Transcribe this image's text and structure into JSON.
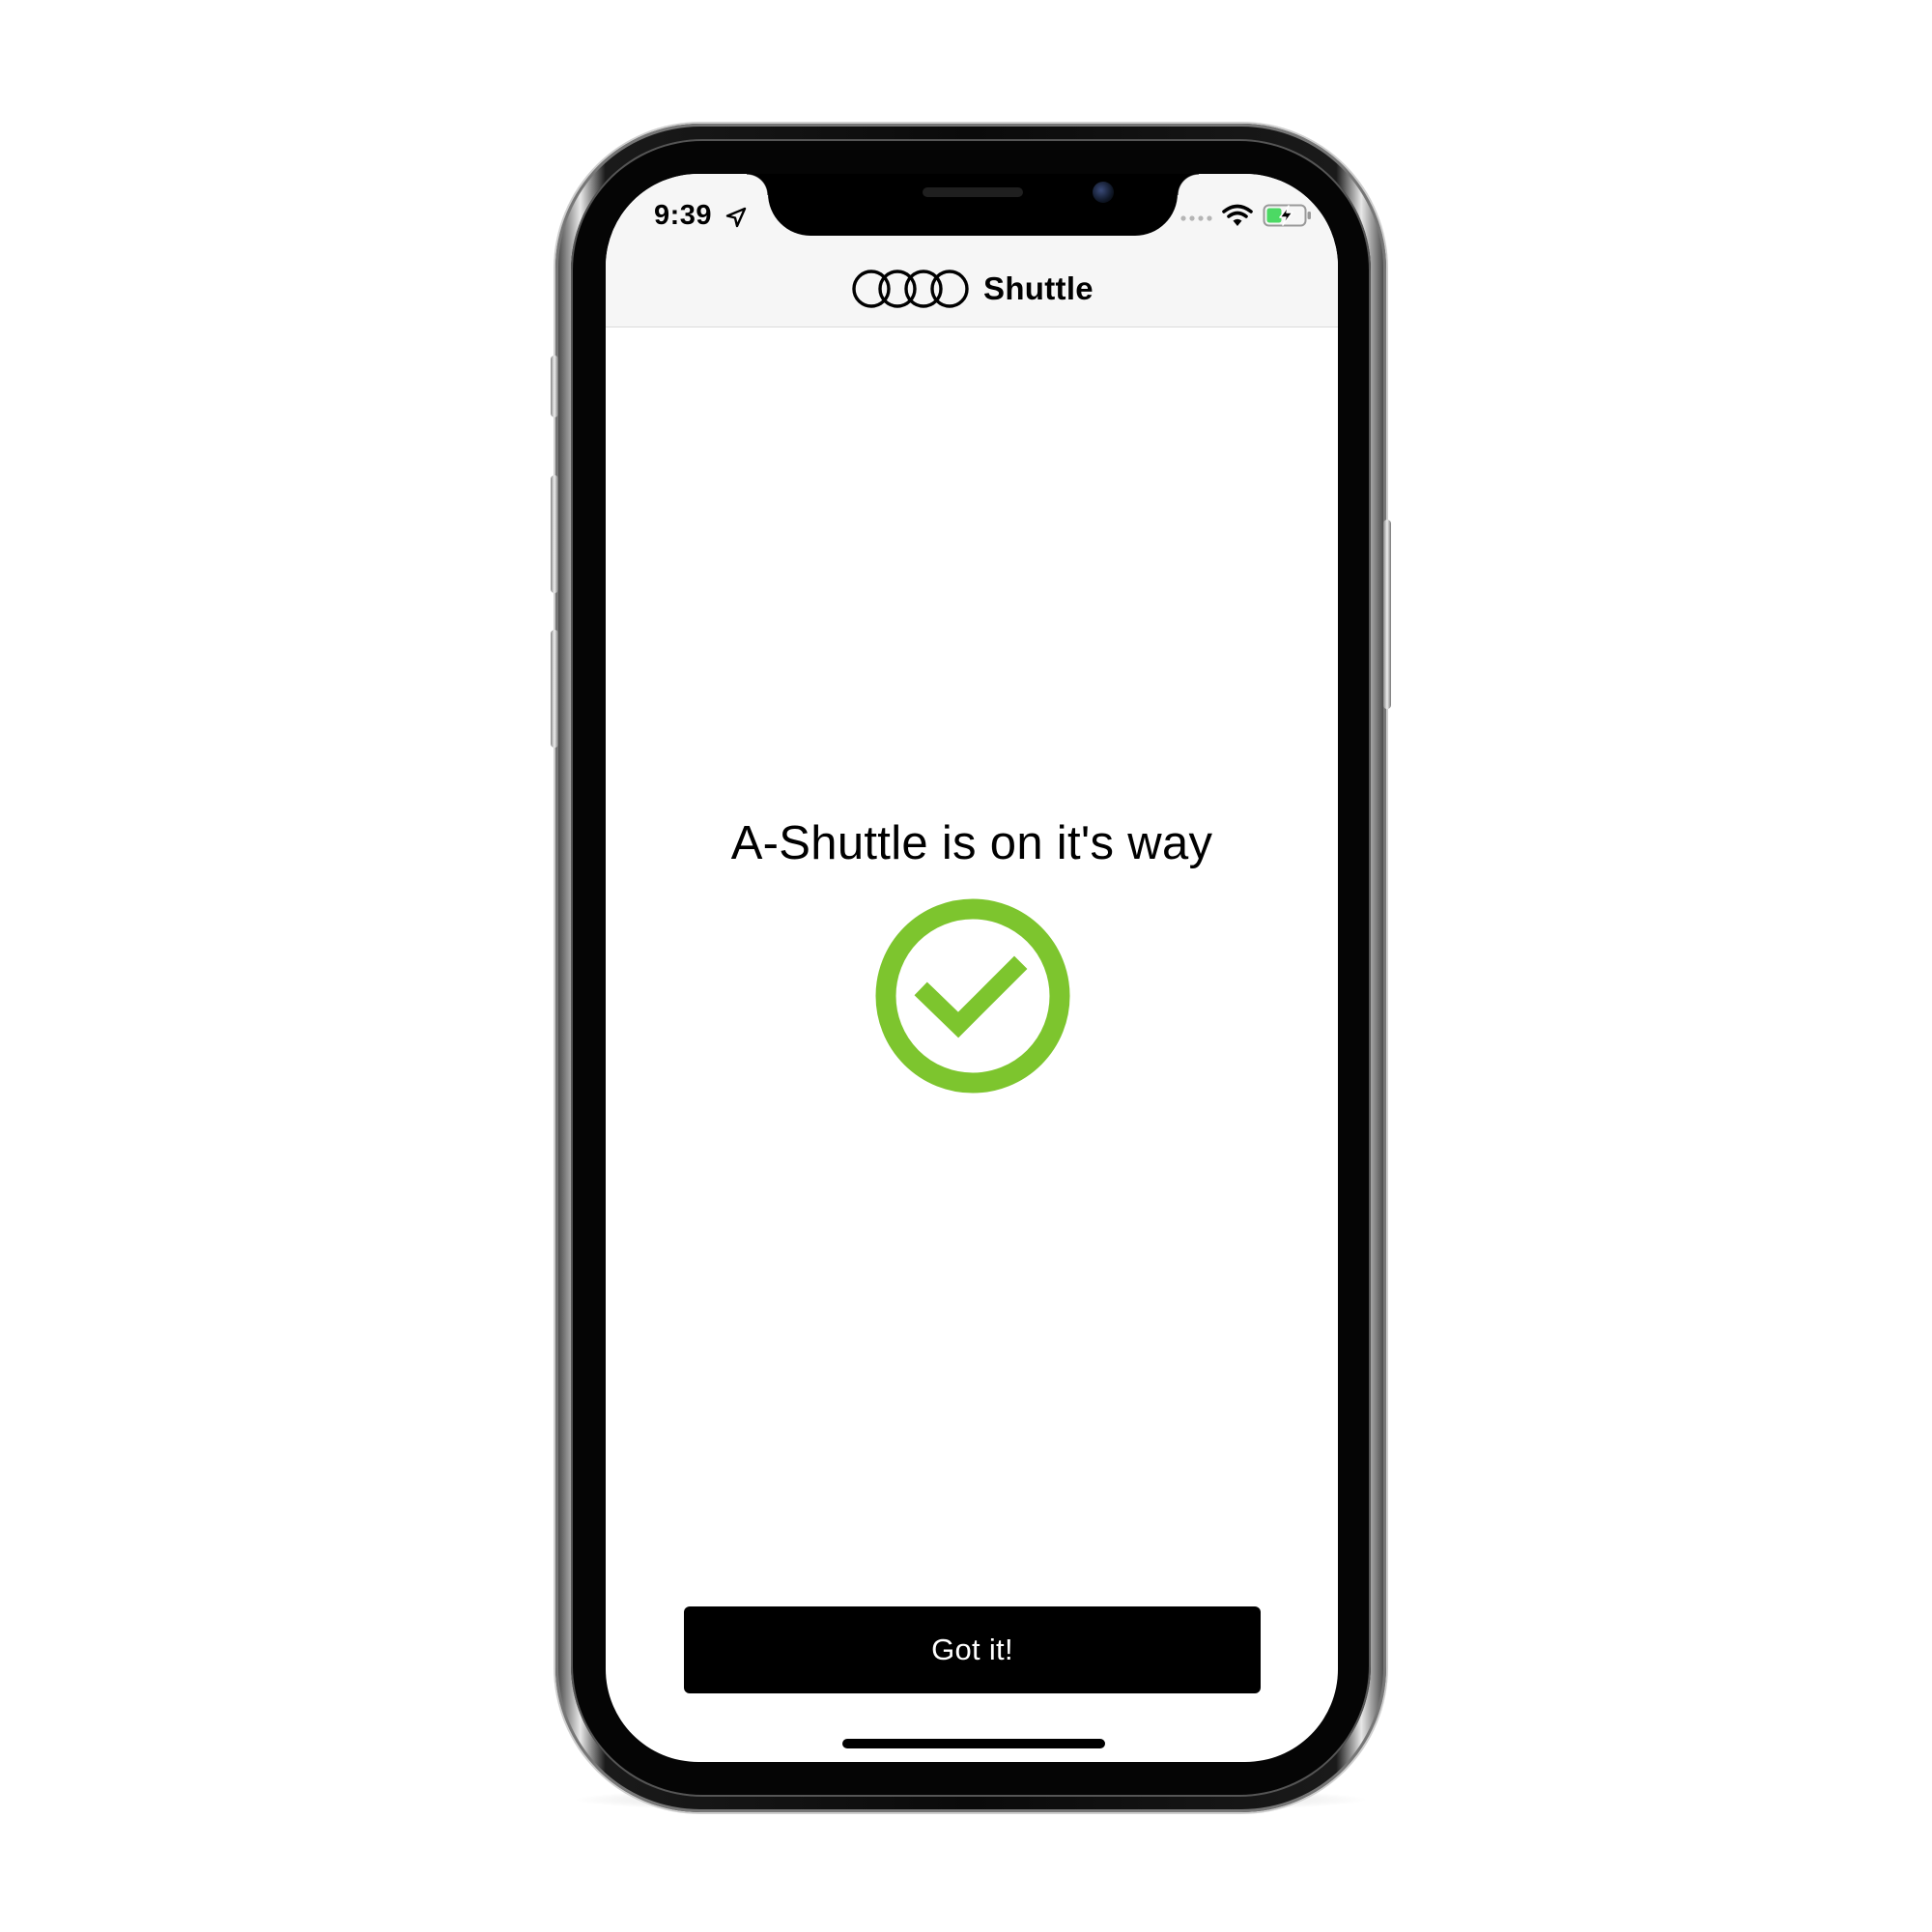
{
  "status_bar": {
    "time": "9:39"
  },
  "header": {
    "brand_name": "Shuttle"
  },
  "main": {
    "headline": "A-Shuttle is on it's way"
  },
  "actions": {
    "got_it_label": "Got it!"
  },
  "colors": {
    "success": "#7dc52e",
    "button_bg": "#000000",
    "header_bg": "#f6f6f6"
  },
  "icons": {
    "brand_logo": "four-rings-icon",
    "status": "checkmark-circle-icon"
  }
}
